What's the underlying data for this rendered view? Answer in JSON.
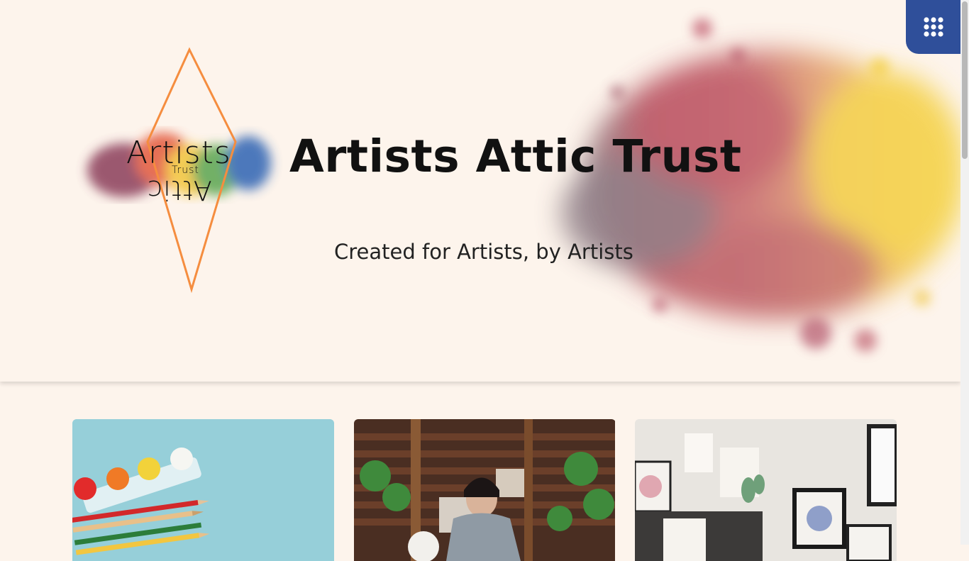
{
  "hero": {
    "title": "Artists Attic Trust",
    "subtitle": "Created for Artists, by Artists"
  },
  "logo": {
    "word_top": "Artists",
    "word_middle": "Trust",
    "word_bottom": "Attic",
    "frame_color": "#f58d3f"
  },
  "menu": {
    "icon": "grid-dots-icon",
    "background": "#2f4f9a"
  },
  "cards": [
    {
      "image": "paint-pots-and-pencils",
      "background": "#8fcbd6"
    },
    {
      "image": "woman-painting-in-studio",
      "background": "#4a2e22"
    },
    {
      "image": "framed-botanical-artworks",
      "background": "#e8e5e0"
    }
  ],
  "colors": {
    "page_background": "#fdf4ec",
    "text": "#111111"
  }
}
